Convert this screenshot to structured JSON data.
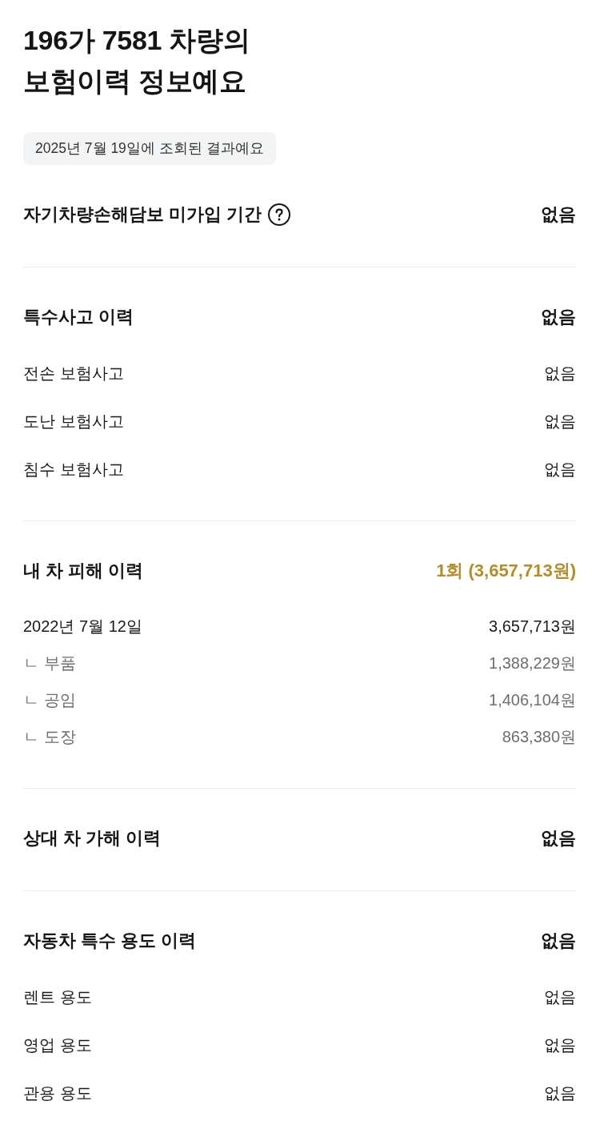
{
  "title": "196가 7581 차량의\n보험이력 정보예요",
  "query_note": "2025년 7월 19일에 조회된 결과예요",
  "sections": [
    {
      "title": "자기차량손해담보 미가입 기간",
      "help": true,
      "value": "없음",
      "highlighted": false
    },
    {
      "title": "특수사고 이력",
      "help": false,
      "value": "없음",
      "highlighted": false,
      "rows": [
        {
          "kind": "item",
          "label": "전손 보험사고",
          "value": "없음"
        },
        {
          "kind": "item",
          "label": "도난 보험사고",
          "value": "없음"
        },
        {
          "kind": "item",
          "label": "침수 보험사고",
          "value": "없음"
        }
      ]
    },
    {
      "title": "내 차 피해 이력",
      "help": false,
      "value": "1회 (3,657,713원)",
      "highlighted": true,
      "rows": [
        {
          "kind": "date",
          "label": "2022년 7월 12일",
          "value": "3,657,713원"
        },
        {
          "kind": "detail",
          "label": "ㄴ 부품",
          "value": "1,388,229원"
        },
        {
          "kind": "detail",
          "label": "ㄴ 공임",
          "value": "1,406,104원"
        },
        {
          "kind": "detail",
          "label": "ㄴ 도장",
          "value": "863,380원"
        }
      ]
    },
    {
      "title": "상대 차 가해 이력",
      "help": false,
      "value": "없음",
      "highlighted": false
    },
    {
      "title": "자동차 특수 용도 이력",
      "help": false,
      "value": "없음",
      "highlighted": false,
      "rows": [
        {
          "kind": "item",
          "label": "렌트 용도",
          "value": "없음"
        },
        {
          "kind": "item",
          "label": "영업 용도",
          "value": "없음"
        },
        {
          "kind": "item",
          "label": "관용 용도",
          "value": "없음"
        }
      ]
    }
  ]
}
